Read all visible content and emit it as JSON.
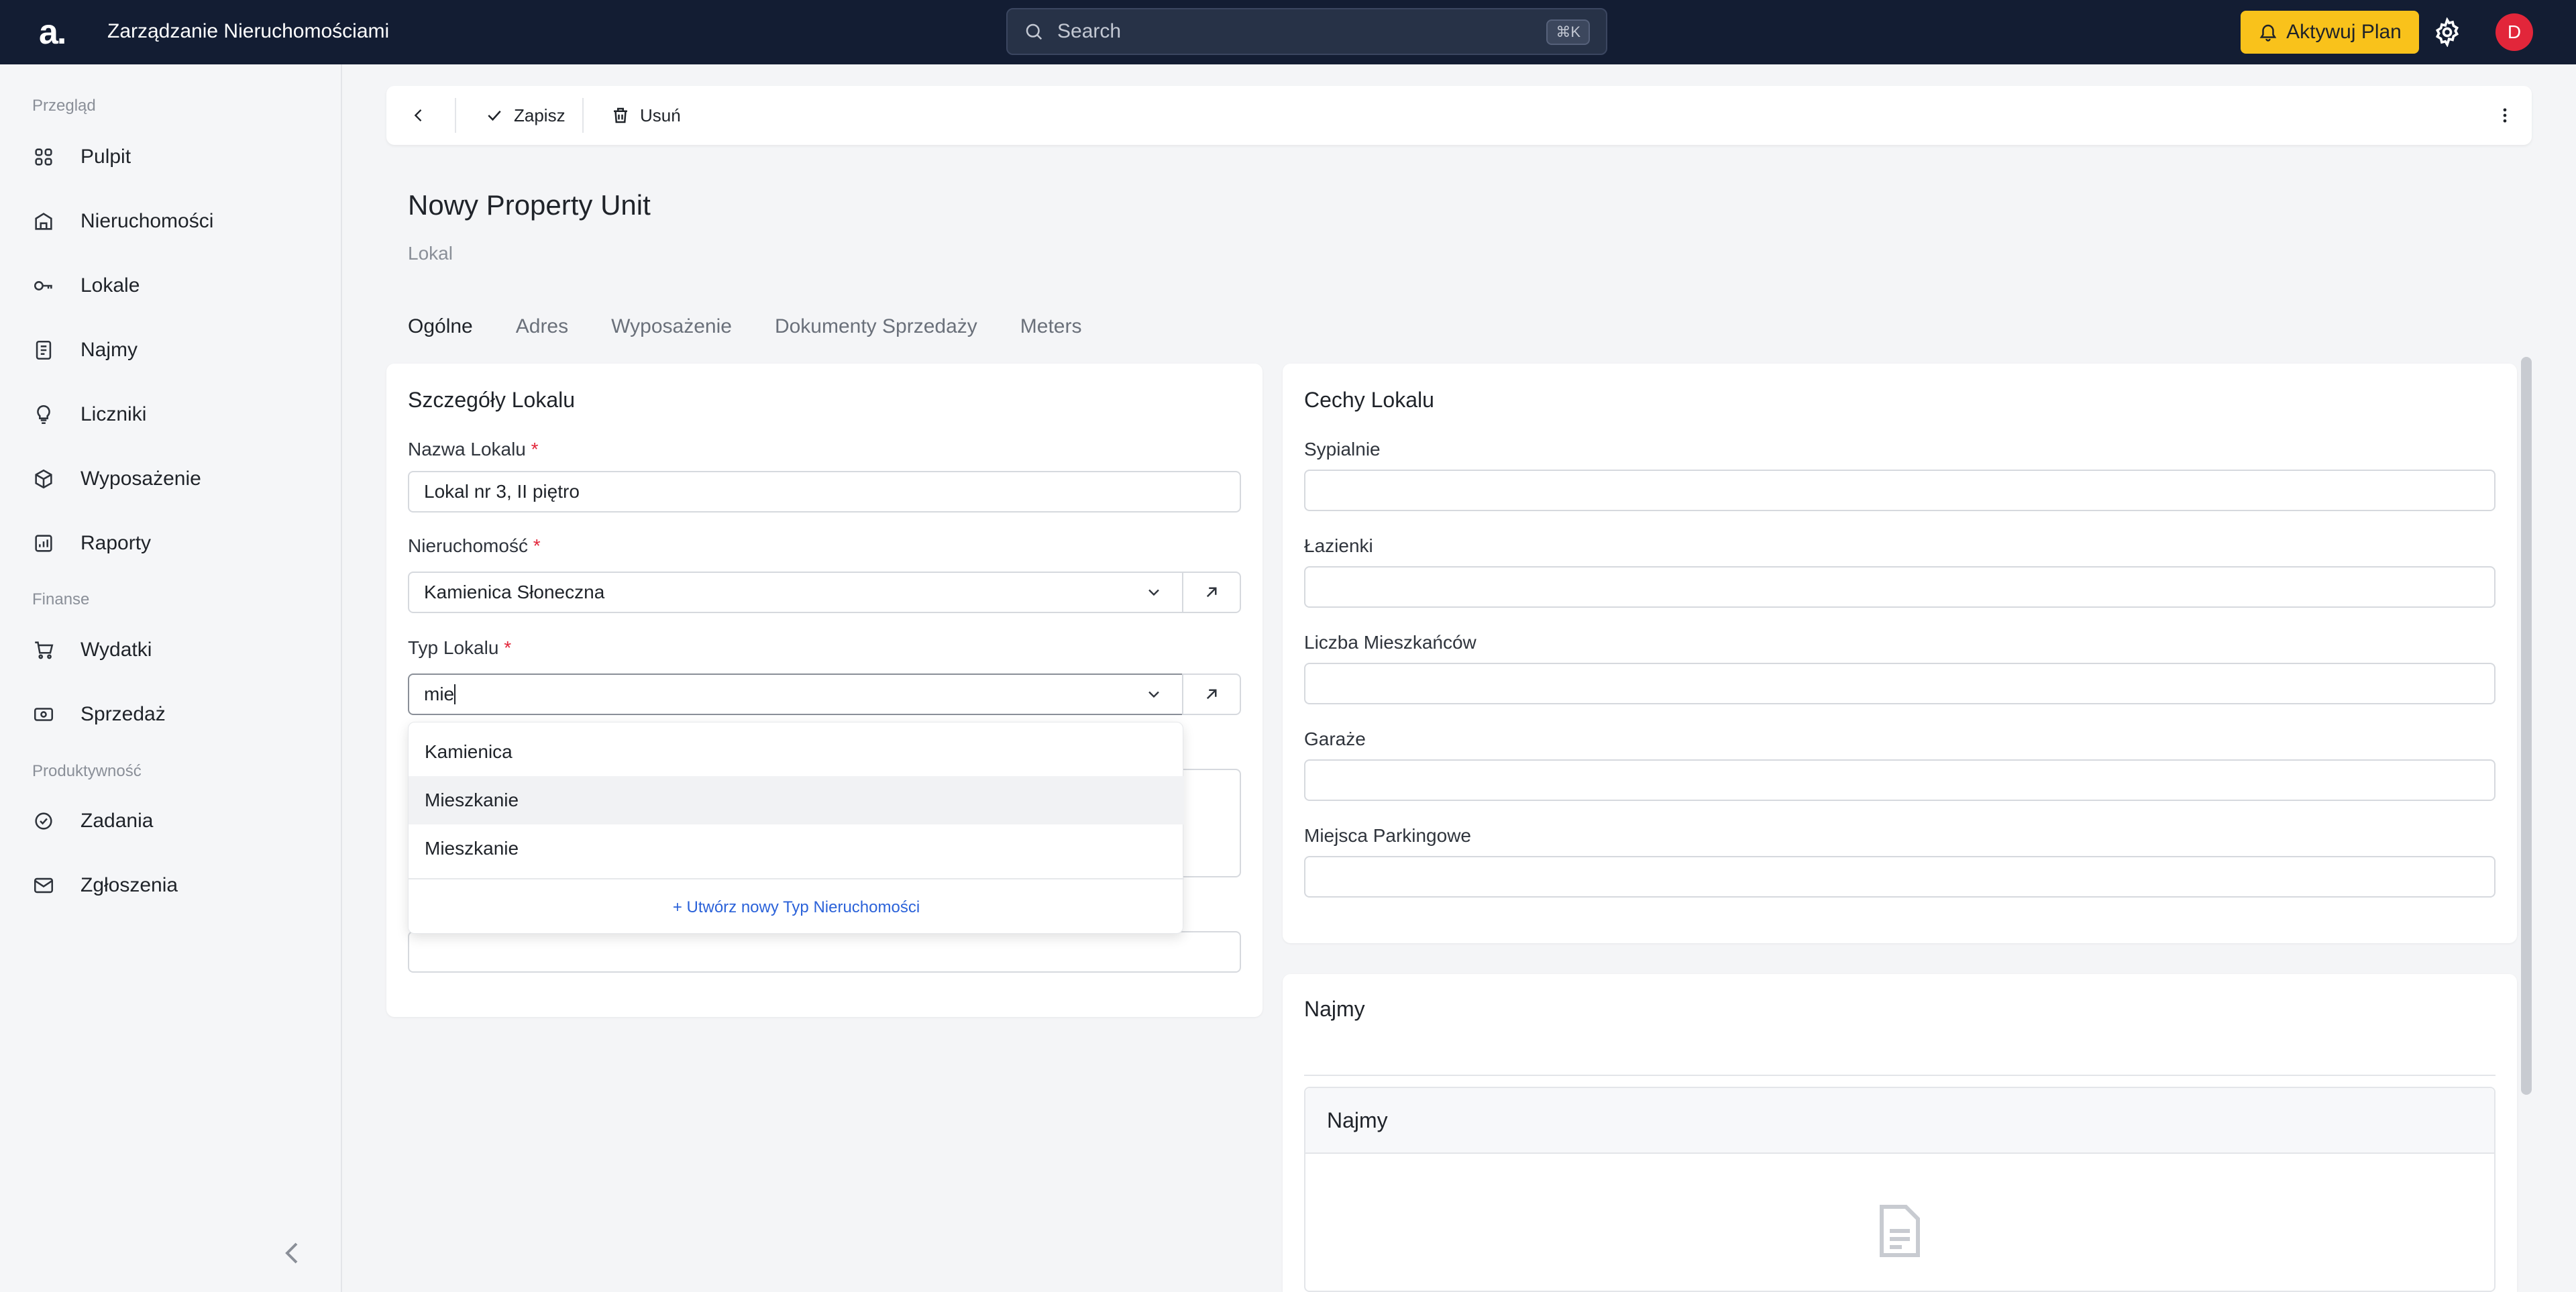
{
  "topbar": {
    "logo": "a.",
    "app_title": "Zarządzanie Nieruchomościami",
    "search_placeholder": "Search",
    "search_shortcut": "⌘K",
    "upgrade_label": "Aktywuj Plan",
    "avatar_initial": "D"
  },
  "sidebar": {
    "sections": [
      {
        "label": "Przegląd",
        "items": [
          "Pulpit",
          "Nieruchomości",
          "Lokale",
          "Najmy",
          "Liczniki",
          "Wyposażenie",
          "Raporty"
        ]
      },
      {
        "label": "Finanse",
        "items": [
          "Wydatki",
          "Sprzedaż"
        ]
      },
      {
        "label": "Produktywność",
        "items": [
          "Zadania",
          "Zgłoszenia"
        ]
      }
    ]
  },
  "toolbar": {
    "save_label": "Zapisz",
    "delete_label": "Usuń"
  },
  "page": {
    "title": "Nowy Property Unit",
    "subtitle": "Lokal"
  },
  "tabs": [
    "Ogólne",
    "Adres",
    "Wyposażenie",
    "Dokumenty Sprzedaży",
    "Meters"
  ],
  "details_card": {
    "title": "Szczegóły Lokalu",
    "name_label": "Nazwa Lokalu",
    "name_value": "Lokal nr 3,  II piętro",
    "property_label": "Nieruchomość",
    "property_value": "Kamienica Słoneczna",
    "type_label": "Typ Lokalu",
    "type_value": "mie",
    "required_mark": "*"
  },
  "dropdown": {
    "options": [
      "Kamienica",
      "Mieszkanie",
      "Mieszkanie"
    ],
    "create_new": "+ Utwórz nowy Typ Nieruchomości"
  },
  "features_card": {
    "title": "Cechy Lokalu",
    "fields": [
      "Sypialnie",
      "Łazienki",
      "Liczba Mieszkańców",
      "Garaże",
      "Miejsca Parkingowe"
    ]
  },
  "leases_card": {
    "title": "Najmy",
    "table_title": "Najmy"
  },
  "colors": {
    "topbar": "#131d33",
    "accent": "#f9c21b",
    "avatar": "#e2263a",
    "link": "#2b62d9"
  }
}
